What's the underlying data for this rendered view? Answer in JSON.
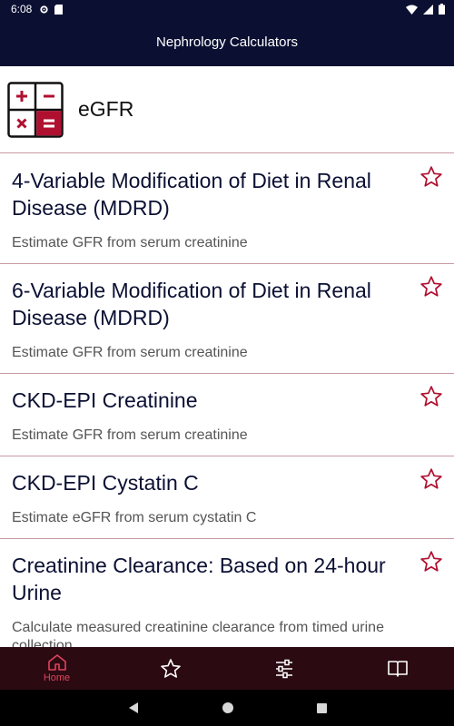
{
  "status_bar": {
    "time": "6:08"
  },
  "app_bar": {
    "title": "Nephrology Calculators"
  },
  "section": {
    "title": "eGFR",
    "icon": "calculator-icon"
  },
  "items": [
    {
      "title": "4-Variable Modification of Diet in Renal Disease (MDRD)",
      "subtitle": "Estimate GFR from serum creatinine"
    },
    {
      "title": "6-Variable Modification of Diet in Renal Disease (MDRD)",
      "subtitle": "Estimate GFR from serum creatinine"
    },
    {
      "title": "CKD-EPI Creatinine",
      "subtitle": "Estimate GFR from serum creatinine"
    },
    {
      "title": "CKD-EPI Cystatin C",
      "subtitle": "Estimate eGFR from serum cystatin C"
    },
    {
      "title": "Creatinine Clearance: Based on 24-hour Urine",
      "subtitle": "Calculate measured creatinine clearance from timed urine collection"
    }
  ],
  "bottom_nav": {
    "home_label": "Home",
    "items": [
      "home-icon",
      "star-icon",
      "sliders-icon",
      "book-icon"
    ]
  },
  "colors": {
    "app_bar": "#0b1033",
    "accent": "#b01030",
    "bottom_nav_bg": "#2b0a12",
    "active": "#e0435c"
  }
}
